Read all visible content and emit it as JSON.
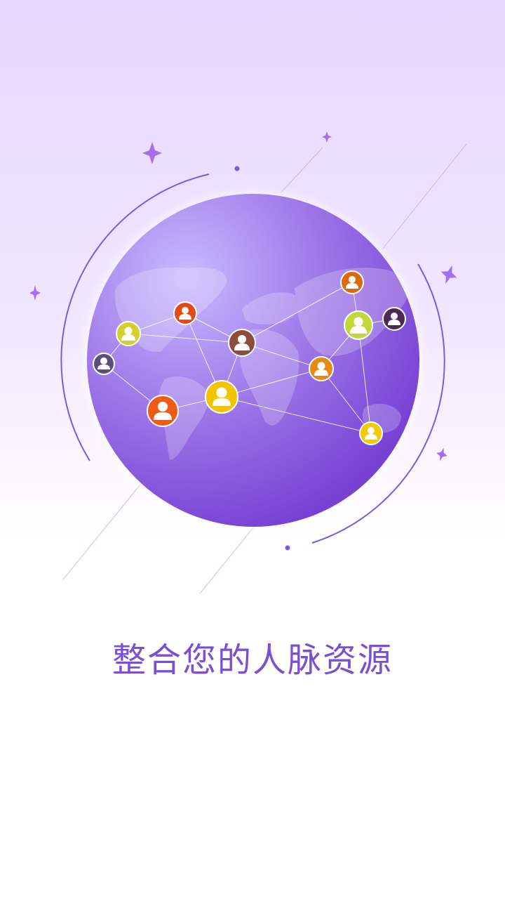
{
  "tagline": "整合您的人脉资源",
  "colors": {
    "accent": "#7a4fd6",
    "globe_light": "#c3b4ff",
    "globe_dark": "#7b43d7",
    "ring": "#7c5ae0"
  },
  "illustration": {
    "globe_icon": "world-map-globe-icon",
    "person_icon": "user-avatar-icon",
    "avatar_colors": [
      "#f5a300",
      "#e44a16",
      "#d4d02a",
      "#8a4f3c",
      "#e48c12",
      "#5c5079",
      "#ef5a16",
      "#f2c400",
      "#dd6a0a",
      "#c2d73a",
      "#4b2a56",
      "#f3c900"
    ]
  }
}
